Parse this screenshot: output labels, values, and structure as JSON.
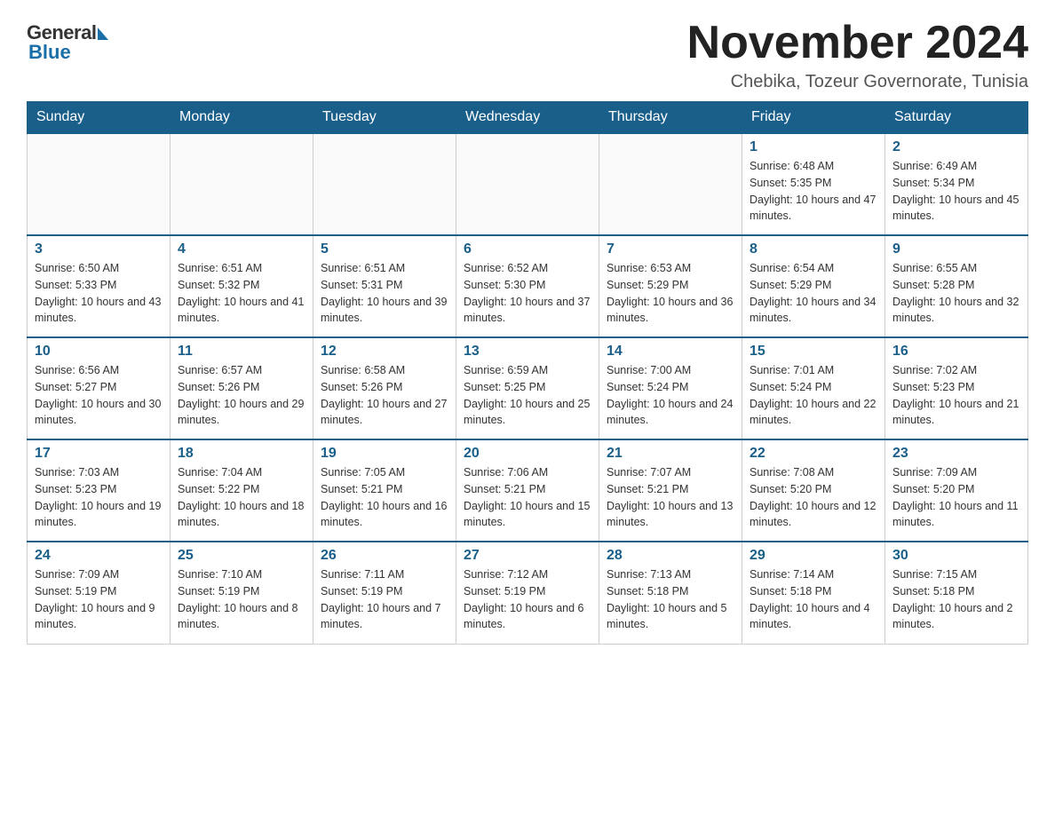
{
  "logo": {
    "general": "General",
    "blue": "Blue"
  },
  "header": {
    "month_year": "November 2024",
    "location": "Chebika, Tozeur Governorate, Tunisia"
  },
  "weekdays": [
    "Sunday",
    "Monday",
    "Tuesday",
    "Wednesday",
    "Thursday",
    "Friday",
    "Saturday"
  ],
  "weeks": [
    [
      {
        "day": "",
        "info": ""
      },
      {
        "day": "",
        "info": ""
      },
      {
        "day": "",
        "info": ""
      },
      {
        "day": "",
        "info": ""
      },
      {
        "day": "",
        "info": ""
      },
      {
        "day": "1",
        "info": "Sunrise: 6:48 AM\nSunset: 5:35 PM\nDaylight: 10 hours and 47 minutes."
      },
      {
        "day": "2",
        "info": "Sunrise: 6:49 AM\nSunset: 5:34 PM\nDaylight: 10 hours and 45 minutes."
      }
    ],
    [
      {
        "day": "3",
        "info": "Sunrise: 6:50 AM\nSunset: 5:33 PM\nDaylight: 10 hours and 43 minutes."
      },
      {
        "day": "4",
        "info": "Sunrise: 6:51 AM\nSunset: 5:32 PM\nDaylight: 10 hours and 41 minutes."
      },
      {
        "day": "5",
        "info": "Sunrise: 6:51 AM\nSunset: 5:31 PM\nDaylight: 10 hours and 39 minutes."
      },
      {
        "day": "6",
        "info": "Sunrise: 6:52 AM\nSunset: 5:30 PM\nDaylight: 10 hours and 37 minutes."
      },
      {
        "day": "7",
        "info": "Sunrise: 6:53 AM\nSunset: 5:29 PM\nDaylight: 10 hours and 36 minutes."
      },
      {
        "day": "8",
        "info": "Sunrise: 6:54 AM\nSunset: 5:29 PM\nDaylight: 10 hours and 34 minutes."
      },
      {
        "day": "9",
        "info": "Sunrise: 6:55 AM\nSunset: 5:28 PM\nDaylight: 10 hours and 32 minutes."
      }
    ],
    [
      {
        "day": "10",
        "info": "Sunrise: 6:56 AM\nSunset: 5:27 PM\nDaylight: 10 hours and 30 minutes."
      },
      {
        "day": "11",
        "info": "Sunrise: 6:57 AM\nSunset: 5:26 PM\nDaylight: 10 hours and 29 minutes."
      },
      {
        "day": "12",
        "info": "Sunrise: 6:58 AM\nSunset: 5:26 PM\nDaylight: 10 hours and 27 minutes."
      },
      {
        "day": "13",
        "info": "Sunrise: 6:59 AM\nSunset: 5:25 PM\nDaylight: 10 hours and 25 minutes."
      },
      {
        "day": "14",
        "info": "Sunrise: 7:00 AM\nSunset: 5:24 PM\nDaylight: 10 hours and 24 minutes."
      },
      {
        "day": "15",
        "info": "Sunrise: 7:01 AM\nSunset: 5:24 PM\nDaylight: 10 hours and 22 minutes."
      },
      {
        "day": "16",
        "info": "Sunrise: 7:02 AM\nSunset: 5:23 PM\nDaylight: 10 hours and 21 minutes."
      }
    ],
    [
      {
        "day": "17",
        "info": "Sunrise: 7:03 AM\nSunset: 5:23 PM\nDaylight: 10 hours and 19 minutes."
      },
      {
        "day": "18",
        "info": "Sunrise: 7:04 AM\nSunset: 5:22 PM\nDaylight: 10 hours and 18 minutes."
      },
      {
        "day": "19",
        "info": "Sunrise: 7:05 AM\nSunset: 5:21 PM\nDaylight: 10 hours and 16 minutes."
      },
      {
        "day": "20",
        "info": "Sunrise: 7:06 AM\nSunset: 5:21 PM\nDaylight: 10 hours and 15 minutes."
      },
      {
        "day": "21",
        "info": "Sunrise: 7:07 AM\nSunset: 5:21 PM\nDaylight: 10 hours and 13 minutes."
      },
      {
        "day": "22",
        "info": "Sunrise: 7:08 AM\nSunset: 5:20 PM\nDaylight: 10 hours and 12 minutes."
      },
      {
        "day": "23",
        "info": "Sunrise: 7:09 AM\nSunset: 5:20 PM\nDaylight: 10 hours and 11 minutes."
      }
    ],
    [
      {
        "day": "24",
        "info": "Sunrise: 7:09 AM\nSunset: 5:19 PM\nDaylight: 10 hours and 9 minutes."
      },
      {
        "day": "25",
        "info": "Sunrise: 7:10 AM\nSunset: 5:19 PM\nDaylight: 10 hours and 8 minutes."
      },
      {
        "day": "26",
        "info": "Sunrise: 7:11 AM\nSunset: 5:19 PM\nDaylight: 10 hours and 7 minutes."
      },
      {
        "day": "27",
        "info": "Sunrise: 7:12 AM\nSunset: 5:19 PM\nDaylight: 10 hours and 6 minutes."
      },
      {
        "day": "28",
        "info": "Sunrise: 7:13 AM\nSunset: 5:18 PM\nDaylight: 10 hours and 5 minutes."
      },
      {
        "day": "29",
        "info": "Sunrise: 7:14 AM\nSunset: 5:18 PM\nDaylight: 10 hours and 4 minutes."
      },
      {
        "day": "30",
        "info": "Sunrise: 7:15 AM\nSunset: 5:18 PM\nDaylight: 10 hours and 2 minutes."
      }
    ]
  ]
}
